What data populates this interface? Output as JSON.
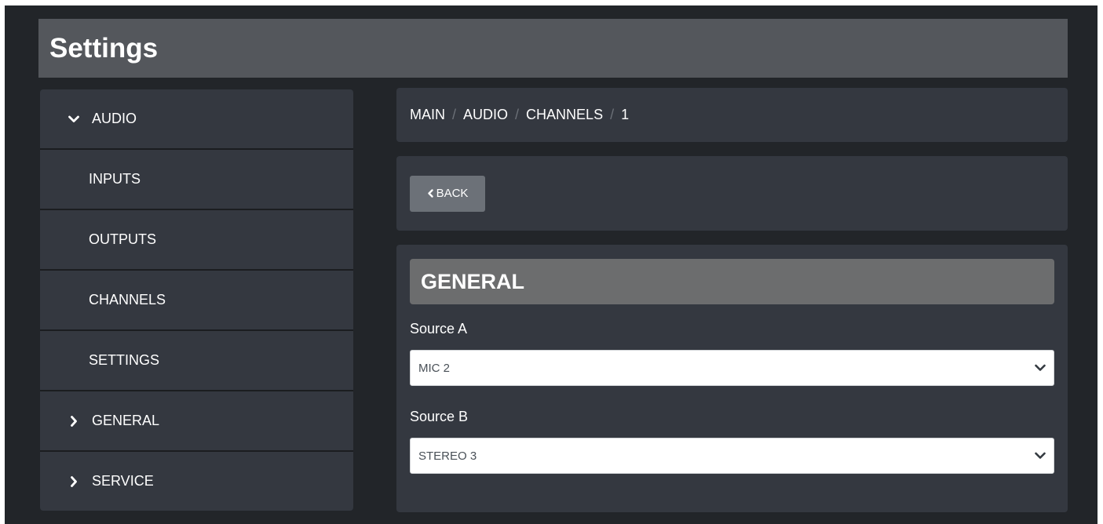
{
  "header": {
    "title": "Settings"
  },
  "sidebar": {
    "items": [
      {
        "label": "AUDIO",
        "icon": "chevron-down-icon",
        "expanded": true
      },
      {
        "label": "INPUTS"
      },
      {
        "label": "OUTPUTS"
      },
      {
        "label": "CHANNELS"
      },
      {
        "label": "SETTINGS"
      },
      {
        "label": "GENERAL",
        "icon": "chevron-right-icon",
        "expanded": false
      },
      {
        "label": "SERVICE",
        "icon": "chevron-right-icon",
        "expanded": false
      }
    ]
  },
  "breadcrumb": {
    "items": [
      "MAIN",
      "AUDIO",
      "CHANNELS",
      "1"
    ],
    "separator": "/"
  },
  "back_button": {
    "label": "BACK",
    "icon": "chevron-left-icon"
  },
  "general": {
    "title": "GENERAL",
    "source_a": {
      "label": "Source A",
      "value": "MIC 2"
    },
    "source_b": {
      "label": "Source B",
      "value": "STEREO 3"
    }
  },
  "colors": {
    "background": "#222529",
    "title_bar": "#54575c",
    "panel": "#343840",
    "section_header": "#6c6d6e",
    "button": "#6c7178",
    "text": "#ffffff"
  }
}
